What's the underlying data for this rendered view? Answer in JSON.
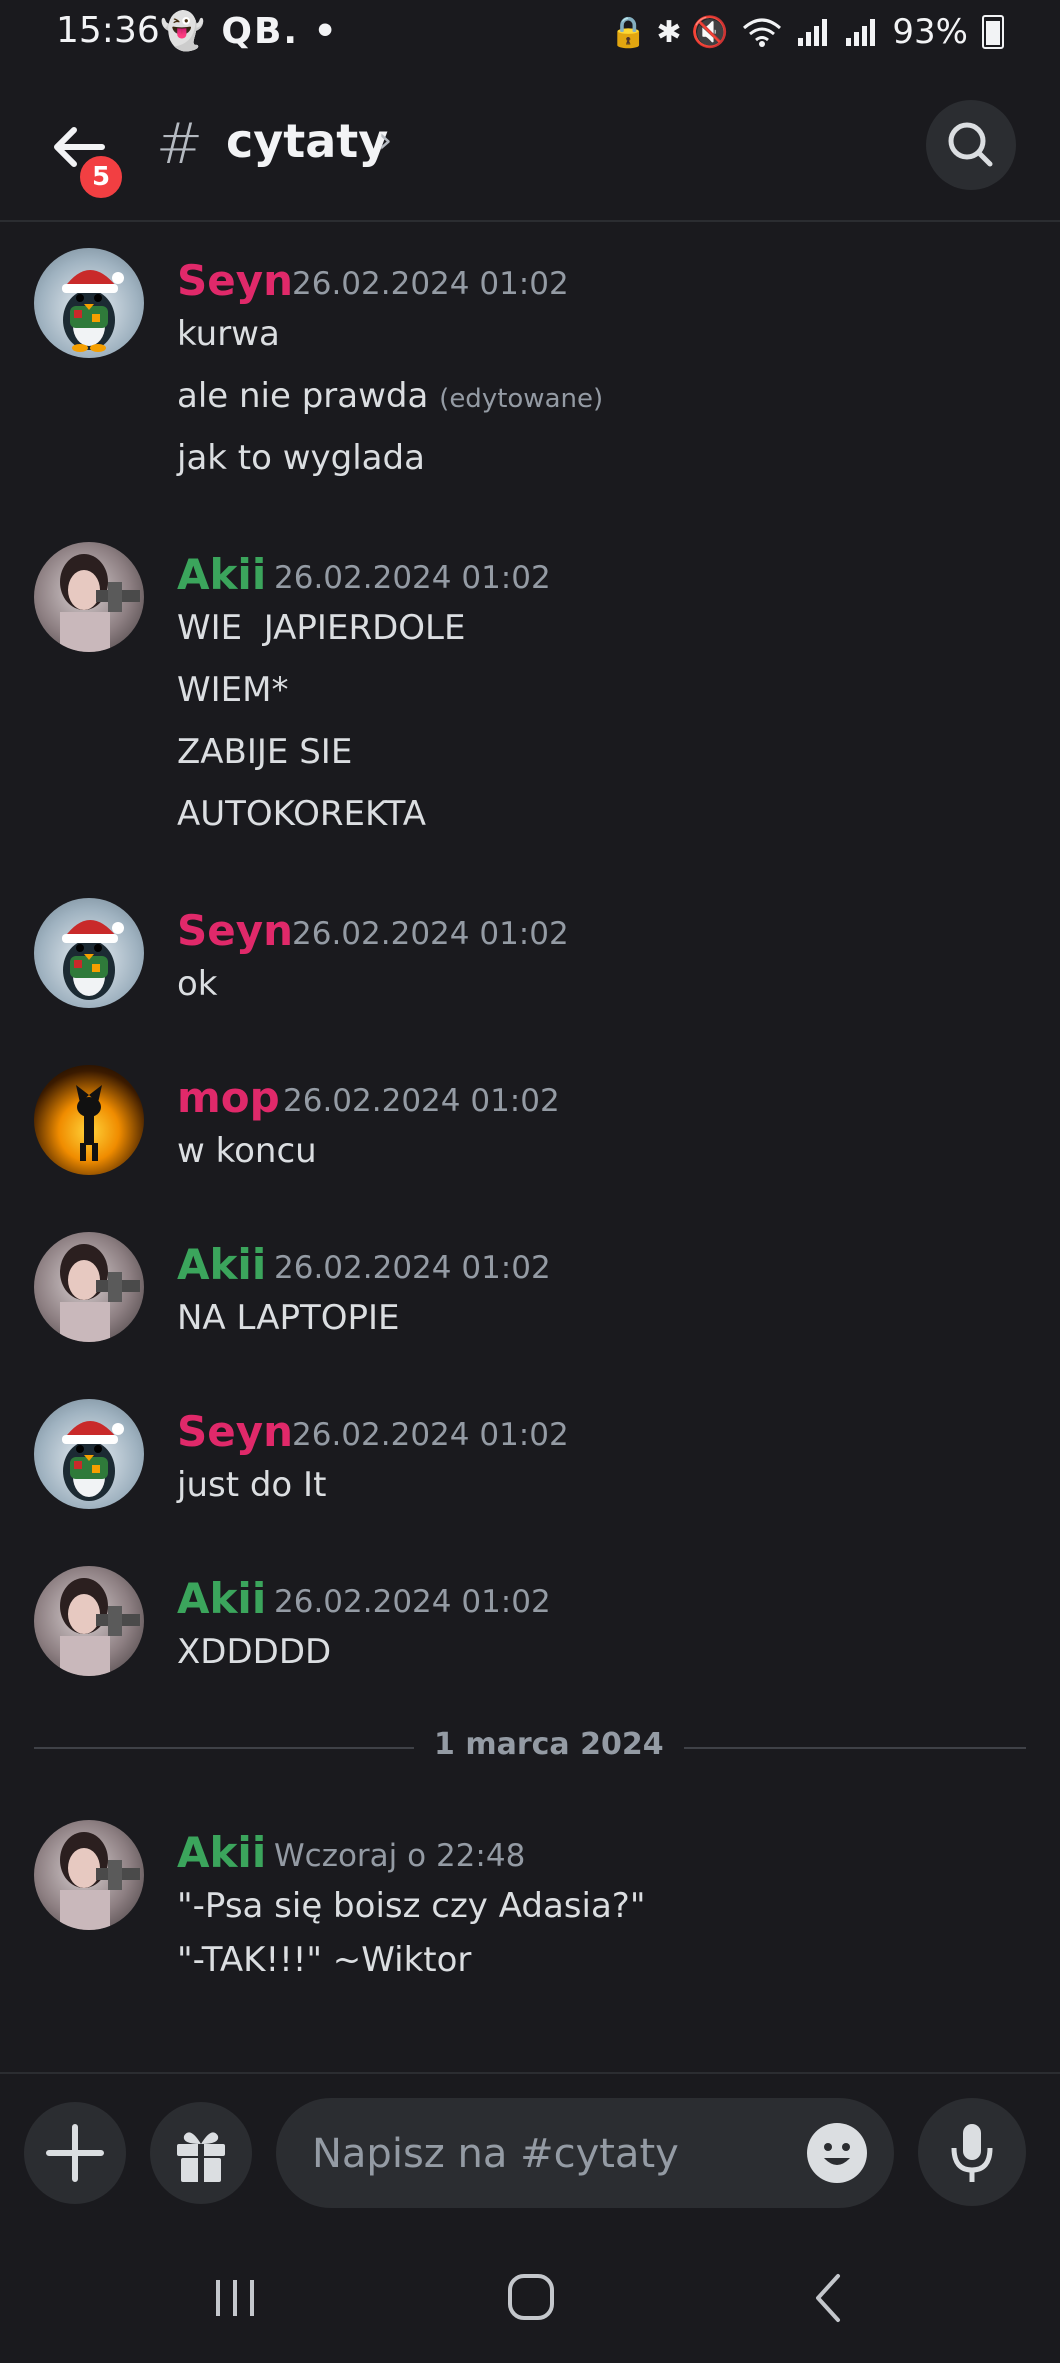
{
  "status_bar": {
    "time": "15:36",
    "left_icons": "👻 QB. •",
    "right_icons": "🔒 ✱ 🔇",
    "battery": "93%"
  },
  "header": {
    "back_badge": "5",
    "hash": "#",
    "channel_name": "cytaty",
    "chevron": "›"
  },
  "messages": [
    {
      "author": "Seyn",
      "timestamp": "26.02.2024 01:02",
      "lines": [
        "kurwa",
        "ale nie prawda",
        "jak to wyglada"
      ],
      "edited": "(edytowane)"
    },
    {
      "author": "Akii",
      "timestamp": "26.02.2024 01:02",
      "lines": [
        "WIE  JAPIERDOLE",
        "WIEM*",
        "ZABIJE SIE",
        "AUTOKOREKTA"
      ]
    },
    {
      "author": "Seyn",
      "timestamp": "26.02.2024 01:02",
      "lines": [
        "ok"
      ]
    },
    {
      "author": "mop",
      "timestamp": "26.02.2024 01:02",
      "lines": [
        "w koncu"
      ]
    },
    {
      "author": "Akii",
      "timestamp": "26.02.2024 01:02",
      "lines": [
        "NA LAPTOPIE"
      ]
    },
    {
      "author": "Seyn",
      "timestamp": "26.02.2024 01:02",
      "lines": [
        "just do It"
      ]
    },
    {
      "author": "Akii",
      "timestamp": "26.02.2024 01:02",
      "lines": [
        "XDDDDD"
      ]
    },
    {
      "author": "Akii",
      "timestamp": "Wczoraj o 22:48",
      "lines": [
        "\"-Psa się boisz czy Adasia?\"",
        "\"-TAK!!!\" ~Wiktor"
      ]
    }
  ],
  "date_divider": "1 marca 2024",
  "composer": {
    "placeholder": "Napisz na #cytaty"
  },
  "colors": {
    "background": "#1a1a1e",
    "seyn": "#e0296a",
    "akii": "#3ba55c",
    "mop": "#e0296a"
  }
}
